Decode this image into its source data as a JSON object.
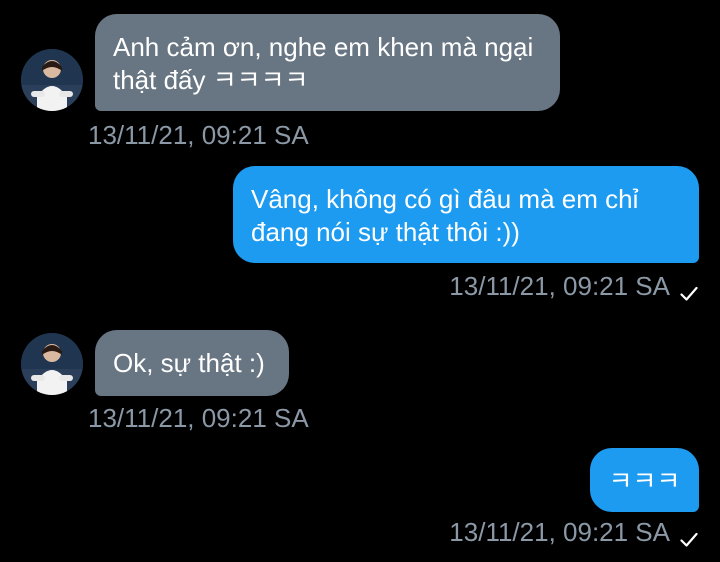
{
  "colors": {
    "background": "#000000",
    "incoming_bubble": "#687582",
    "outgoing_bubble": "#1d9bf0",
    "timestamp": "#8b98a5"
  },
  "messages": [
    {
      "direction": "incoming",
      "text": "Anh cảm ơn, nghe em khen mà ngại\nthật đấy ㅋㅋㅋㅋ",
      "timestamp": "13/11/21, 09:21 SA",
      "avatar_icon": "user-avatar"
    },
    {
      "direction": "outgoing",
      "text": "Vâng, không có gì đâu mà em chỉ\nđang nói sự thật thôi :))",
      "timestamp": "13/11/21, 09:21 SA",
      "status_icon": "checkmark-icon"
    },
    {
      "direction": "incoming",
      "text": "Ok, sự thật :)",
      "timestamp": "13/11/21, 09:21 SA",
      "avatar_icon": "user-avatar"
    },
    {
      "direction": "outgoing",
      "text": "ㅋㅋㅋ",
      "timestamp": "13/11/21, 09:21 SA",
      "status_icon": "checkmark-icon"
    }
  ]
}
